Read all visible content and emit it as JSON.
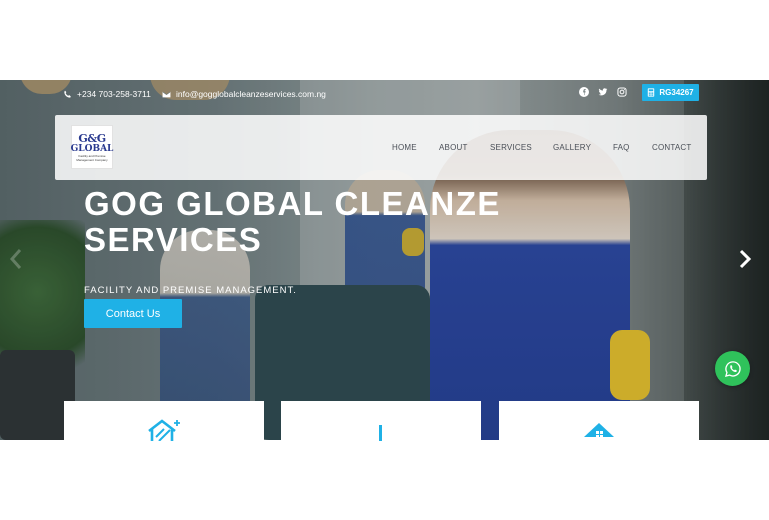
{
  "colors": {
    "accent": "#1fb1e6",
    "whatsapp": "#2fc25b",
    "nav_text": "#4a4f57"
  },
  "topbar": {
    "phone": "+234 703-258-3711",
    "email": "info@gogglobalcleanzeservices.com.ng",
    "social_icons": [
      "facebook-icon",
      "twitter-icon",
      "instagram-icon"
    ],
    "badge": "RG34267"
  },
  "logo": {
    "mark": "G&G",
    "word": "GLOBAL",
    "tagline": "Facility and Premise Management Company"
  },
  "nav": {
    "items": [
      "HOME",
      "ABOUT",
      "SERVICES",
      "GALLERY",
      "FAQ",
      "CONTACT"
    ]
  },
  "hero": {
    "title_line1": "GOG GLOBAL CLEANZE",
    "title_line2": "SERVICES",
    "subtitle": "FACILITY AND PREMISE MANAGEMENT.",
    "cta_label": "Contact Us"
  },
  "cards": [
    {
      "icon": "house-cleaning-icon"
    },
    {
      "icon": "spray-bottle-icon"
    },
    {
      "icon": "home-icon"
    }
  ]
}
